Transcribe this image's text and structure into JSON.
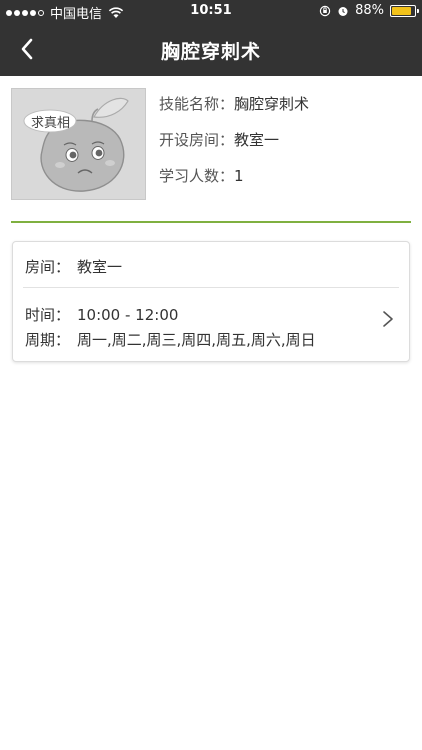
{
  "status_bar": {
    "carrier": "中国电信",
    "time": "10:51",
    "battery_percent": "88%",
    "battery_level": 0.88,
    "battery_color": "#f2c21b"
  },
  "nav": {
    "title": "胸腔穿刺术",
    "back_icon": "chevron-left-icon"
  },
  "skill": {
    "image_caption": "求真相",
    "name_label": "技能名称：",
    "name_value": "胸腔穿刺术",
    "room_label": "开设房间：",
    "room_value": "教室一",
    "learners_label": "学习人数：",
    "learners_value": "1"
  },
  "schedule": {
    "room_label": "房间：",
    "room_value": "教室一",
    "time_label": "时间：",
    "time_value": "10:00 - 12:00",
    "week_label": "周期：",
    "week_value": "周一,周二,周三,周四,周五,周六,周日",
    "chevron_icon": "chevron-right-icon"
  },
  "colors": {
    "header_bg": "#333333",
    "accent_green": "#7fb040"
  }
}
